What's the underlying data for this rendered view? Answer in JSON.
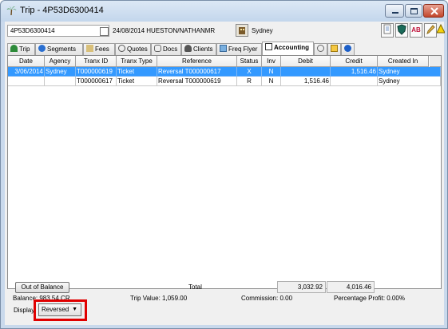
{
  "window": {
    "title": "Trip - 4P53D6300414"
  },
  "toolbar": {
    "trip_number": "4P53D6300414",
    "date_user": "24/08/2014 HUESTON/NATHANMR",
    "location": "Sydney",
    "icons": [
      "document-icon",
      "shield-icon",
      "spellcheck-icon",
      "edit-icon",
      "warning-icon"
    ],
    "spellcheck_label": "AB"
  },
  "tabs": [
    {
      "label": "Trip",
      "icon": "palm-icon"
    },
    {
      "label": "Segments",
      "icon": "globe-icon"
    },
    {
      "label": "Fees",
      "icon": "fees-icon"
    },
    {
      "label": "Quotes",
      "icon": "speech-icon"
    },
    {
      "label": "Docs",
      "icon": "paperclip-icon"
    },
    {
      "label": "Clients",
      "icon": "people-icon"
    },
    {
      "label": "Freq Flyer",
      "icon": "card-icon"
    },
    {
      "label": "Accounting",
      "icon": "ledger-icon"
    },
    {
      "label": "",
      "icon": "link-icon"
    },
    {
      "label": "",
      "icon": "notes-icon"
    },
    {
      "label": "",
      "icon": "info-icon"
    }
  ],
  "grid": {
    "columns": [
      "Date",
      "Agency",
      "Tranx ID",
      "Tranx Type",
      "Reference",
      "Status",
      "Inv",
      "Debit",
      "Credit",
      "Created In"
    ],
    "rows": [
      {
        "selected": true,
        "cells": [
          "3/06/2014",
          "Sydney",
          "T000000619",
          "Ticket",
          "Reversal T000000617",
          "X",
          "N",
          "",
          "1,516.46",
          "Sydney"
        ]
      },
      {
        "selected": false,
        "cells": [
          "",
          "",
          "T000000617",
          "Ticket",
          "Reversal T000000619",
          "R",
          "N",
          "1,516.46",
          "",
          "Sydney"
        ]
      }
    ]
  },
  "footer": {
    "out_of_balance_label": "Out of Balance",
    "total_label": "Total",
    "total_debit": "3,032.92",
    "total_credit": "4,016.46",
    "balance": "Balance: 983.54 CR",
    "trip_value": "Trip Value: 1,059.00",
    "commission": "Commission: 0.00",
    "percentage_profit": "Percentage Profit: 0.00%",
    "display_label": "Display",
    "display_value": "Reversed"
  },
  "colors": {
    "selection": "#3399ff",
    "highlight_box": "#e00000",
    "title_bar": "#c3d6ec"
  }
}
